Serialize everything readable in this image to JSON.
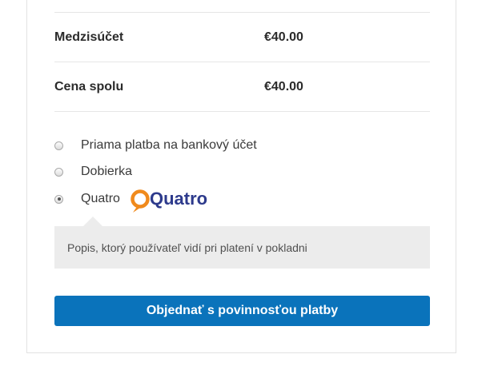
{
  "totals": {
    "subtotal": {
      "label": "Medzisúčet",
      "value": "€40.00"
    },
    "total": {
      "label": "Cena spolu",
      "value": "€40.00"
    }
  },
  "payment_methods": [
    {
      "label": "Priama platba na bankový účet",
      "selected": false
    },
    {
      "label": "Dobierka",
      "selected": false
    },
    {
      "label": "Quatro",
      "selected": true,
      "logo_text": "Quatro",
      "logo_color": "#2d3a8c",
      "logo_accent": "#f08a1c"
    }
  ],
  "payment_description": "Popis, ktorý používateľ vidí pri platení v pokladni",
  "place_order_label": "Objednať s povinnosťou platby",
  "colors": {
    "button": "#0a73bb",
    "description_bg": "#ececec"
  }
}
